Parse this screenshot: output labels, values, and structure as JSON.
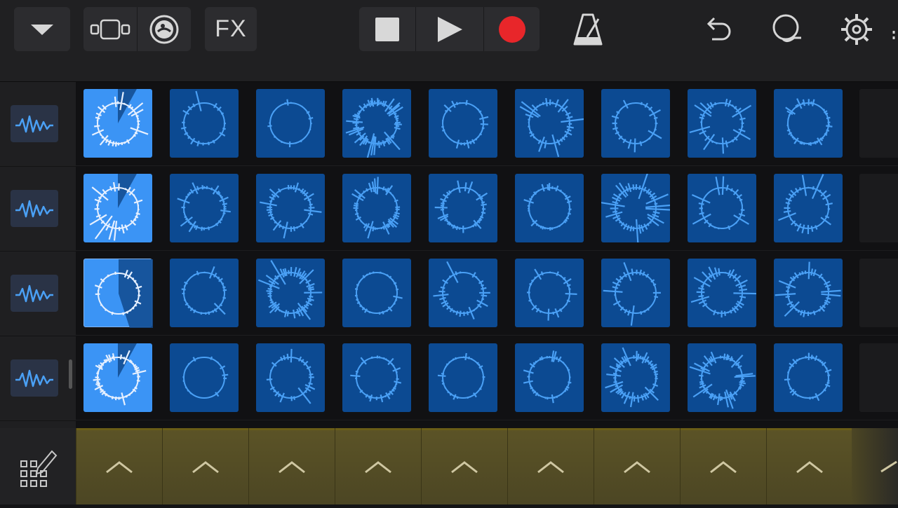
{
  "toolbar": {
    "fx_label": "FX",
    "buttons": [
      "browser-dropdown",
      "tracks-view",
      "live-loops-view",
      "fx",
      "stop",
      "play",
      "record",
      "metronome",
      "undo",
      "loop-browser",
      "settings"
    ],
    "record_color": "#e8262a"
  },
  "grid": {
    "rows": 4,
    "columns": 9,
    "cell_color": "#0c4a92",
    "active_color": "#3b94f5",
    "waveform_color": "#4aa0f5",
    "active_cells": [
      [
        0,
        0
      ],
      [
        1,
        0
      ],
      [
        2,
        0
      ],
      [
        3,
        0
      ]
    ],
    "playing_progress": [
      0.08,
      0.08,
      0.45,
      0.08
    ]
  },
  "tracks": [
    {
      "icon": "waveform-icon"
    },
    {
      "icon": "waveform-icon"
    },
    {
      "icon": "waveform-icon"
    },
    {
      "icon": "waveform-icon"
    }
  ],
  "triggers": {
    "count": 9,
    "icon": "chevron-up-icon",
    "color": "#5b5326"
  }
}
